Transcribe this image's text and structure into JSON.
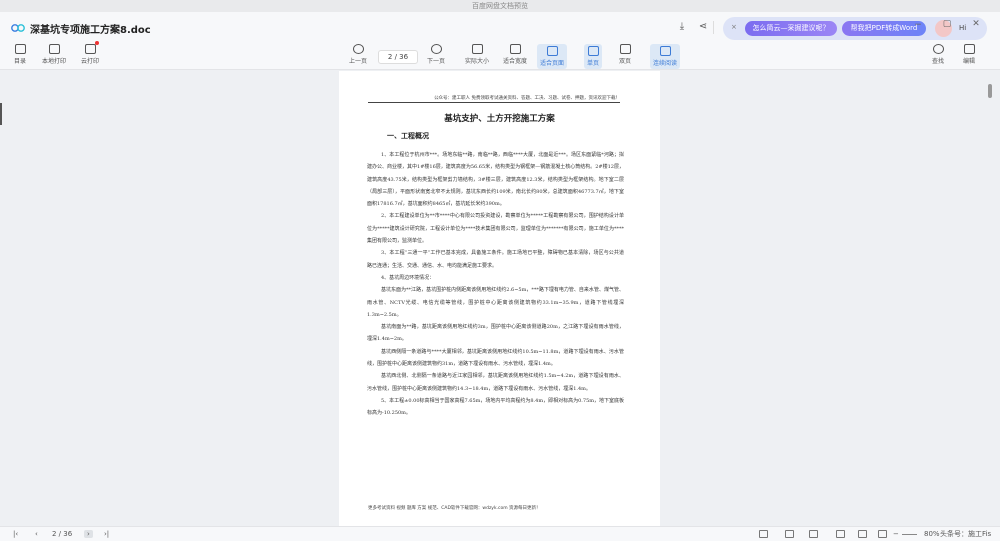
{
  "window": {
    "title": "百度网盘文档预览"
  },
  "file": {
    "name": "深基坑专项施工方案8.doc"
  },
  "ai": {
    "close": "×",
    "suggest_label": "怎么简云—采掘建议呢？",
    "convert_label": "帮我把PDF转成Word",
    "greeting": "Hi"
  },
  "toolbar": {
    "left": [
      {
        "label": "目录",
        "icon": "toc-icon"
      },
      {
        "label": "本地打印",
        "icon": "print-icon"
      },
      {
        "label": "云打印",
        "icon": "cloud-print-icon"
      }
    ],
    "prev": "上一页",
    "page": "2 / 36",
    "next": "下一页",
    "views": [
      {
        "label": "实际大小",
        "active": false
      },
      {
        "label": "适合宽度",
        "active": false
      },
      {
        "label": "适合页面",
        "active": true
      },
      {
        "label": "单页",
        "active": true
      },
      {
        "label": "双页",
        "active": false
      },
      {
        "label": "连续阅读",
        "active": true
      }
    ],
    "find": "查找",
    "edit": "编辑"
  },
  "document": {
    "header": "公众号：建工职人  免费领取考试通关资料、答题、工决、习题、试卷、押题，资讯欢迎下载！",
    "title": "基坑支护、土方开挖施工方案",
    "section": "一、工程概况",
    "paragraphs": [
      "1、本工程位于杭州市***。场地东临**路，南临**路，西临****大厦，北面是近***。场区东面紧临*河路；拟建办公、商业楼，其中1#楼16层，建筑高度为56.65米，结构类型为钢框架—钢筋混凝土核心筒结构。2#楼12层，建筑高度43.75米，结构类型为框架剪力墙结构，3#楼三层，建筑高度12.3米，结构类型为框架结构。地下室二层（局部三层），平面形状南宽北窄不太规则，基坑东西长约109米，南北长约80米，总建筑面积46773.7㎡，地下室面积17816.7㎡，基坑面积约8465㎡，基坑延长米约390m。",
      "2、本工程建设单位为**市****中心有限公司投资建设，勘察单位为*****工程勘察有限公司，围护结构设计单位为*****建筑设计研究院，工程设计单位为****技术集团有限公司，监理单位为*******有限公司，施工单位为****集团有限公司，监测单位。",
      "3、本工程“三通一平”工作已基本完成，具备施工条件。施工场地已平整，障碍物已基本清除，场区与公共道路已连通；生活、交通、通信、水、电均能满足施工要求。",
      "4、基坑周边环境情况：",
      "基坑东面为**江路，基坑围护桩内侧距离该侧用地红线约2.6~5m，***路下埋有电力管、自来水管、煤气管、雨水管、NCTV光缆、电信光缆等管线，围护桩中心距离该侧建筑物约33.1m~35.9m，道路下管线埋深1.3m~2.5m。",
      "基坑南面为**路，基坑距离该侧用地红线约3m，围护桩中心距离该侧道路20m，之江路下埋设有雨水管线，埋深1.4m~2m。",
      "基坑西侧隔一条道路与****大厦相邻，基坑距离该侧用地红线约10.5m~11.8m，道路下埋设有雨水、污水管线，围护桩中心距离该侧建筑物约31m，道路下埋设有雨水、污水管线，埋深1.4m。",
      "基坑西北侧、北侧隔一条道路与近江家园相邻，基坑距离该侧用地红线约1.5m~4.2m，道路下埋设有雨水、污水管线，围护桩中心距离该侧建筑物约14.3~18.4m，道路下埋设有雨水、污水管线，埋深1.4m。",
      "5、本工程±0.00标高相当于国家高程7.65m，场地内平均高程约为8.4m，即相对标高为0.75m，地下室底板标高为-10.250m。"
    ],
    "footer": "更多考试资料  视频  题库  方案  规范、CAD软件下载官网：wdzyk.com 资源每日更新！"
  },
  "status": {
    "page": "2 / 36",
    "zoom": "80%",
    "watermark": "头条号：施工Fis"
  }
}
